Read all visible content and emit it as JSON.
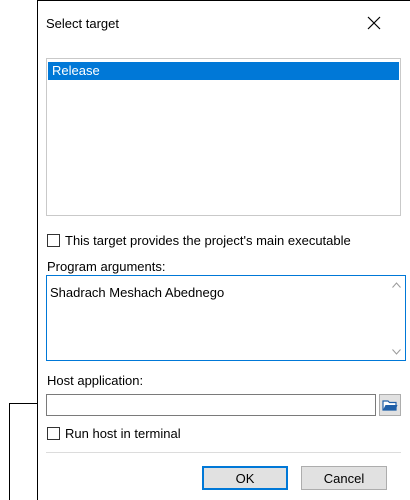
{
  "dialog": {
    "title": "Select target",
    "close_icon": "close-icon"
  },
  "targets": {
    "items": [
      {
        "label": "Release",
        "selected": true
      }
    ]
  },
  "main_executable": {
    "label": "This target provides the project's main executable",
    "checked": false
  },
  "program_arguments": {
    "label": "Program arguments:",
    "value": "Shadrach Meshach Abednego"
  },
  "host_application": {
    "label": "Host application:",
    "value": "",
    "browse_icon": "folder-open-icon"
  },
  "run_in_terminal": {
    "label": "Run host in terminal",
    "checked": false
  },
  "buttons": {
    "ok": "OK",
    "cancel": "Cancel"
  },
  "colors": {
    "selection": "#0078d7",
    "focus_border": "#0078d7",
    "button_face": "#e1e1e1",
    "folder_icon": "#1f5fa8"
  }
}
